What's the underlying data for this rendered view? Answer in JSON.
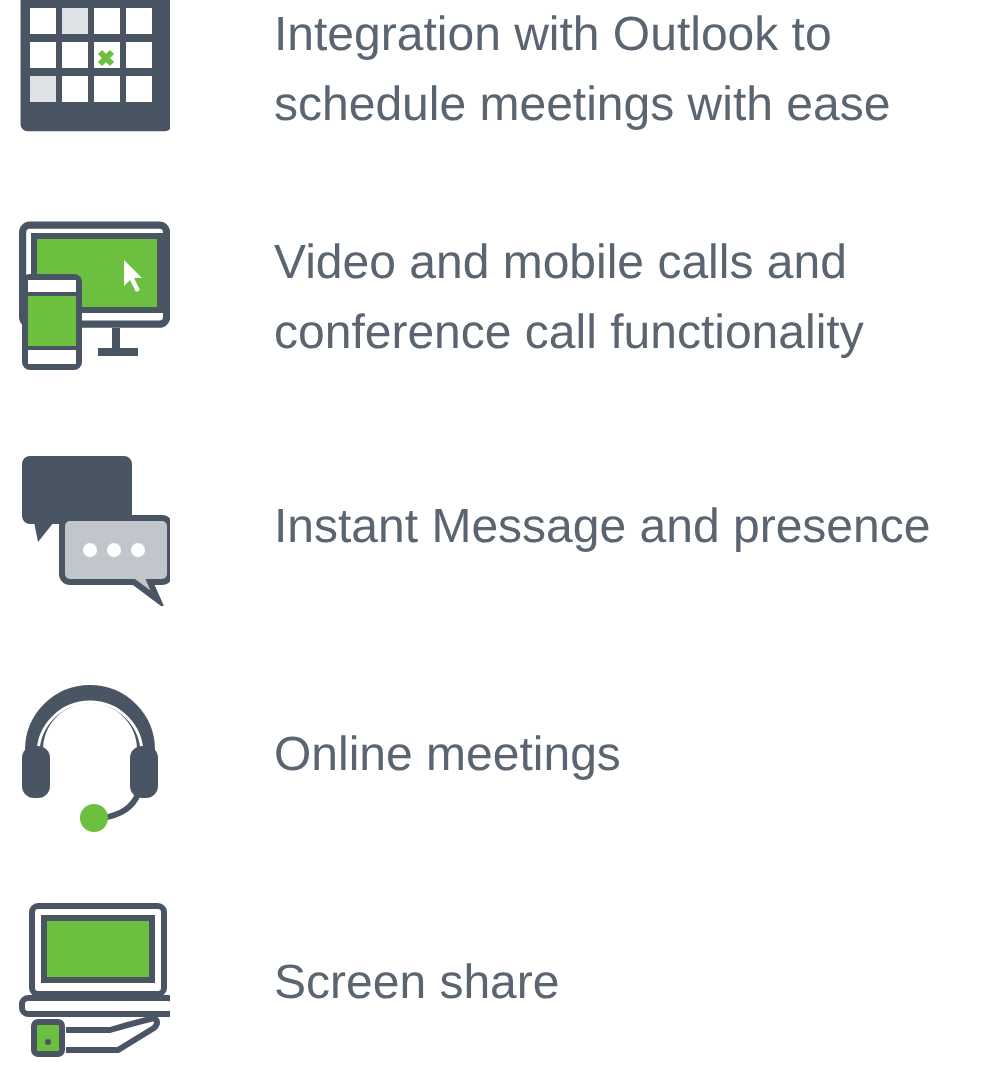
{
  "features": [
    {
      "kind": "calendar",
      "lines": [
        "Integration with Outlook to",
        "schedule meetings with ease"
      ]
    },
    {
      "kind": "devices",
      "lines": [
        "Video and mobile calls and",
        "conference call functionality"
      ]
    },
    {
      "kind": "chat",
      "lines": [
        "Instant Message and presence"
      ]
    },
    {
      "kind": "headset",
      "lines": [
        "Online meetings"
      ]
    },
    {
      "kind": "screen",
      "lines": [
        "Screen share"
      ]
    }
  ]
}
